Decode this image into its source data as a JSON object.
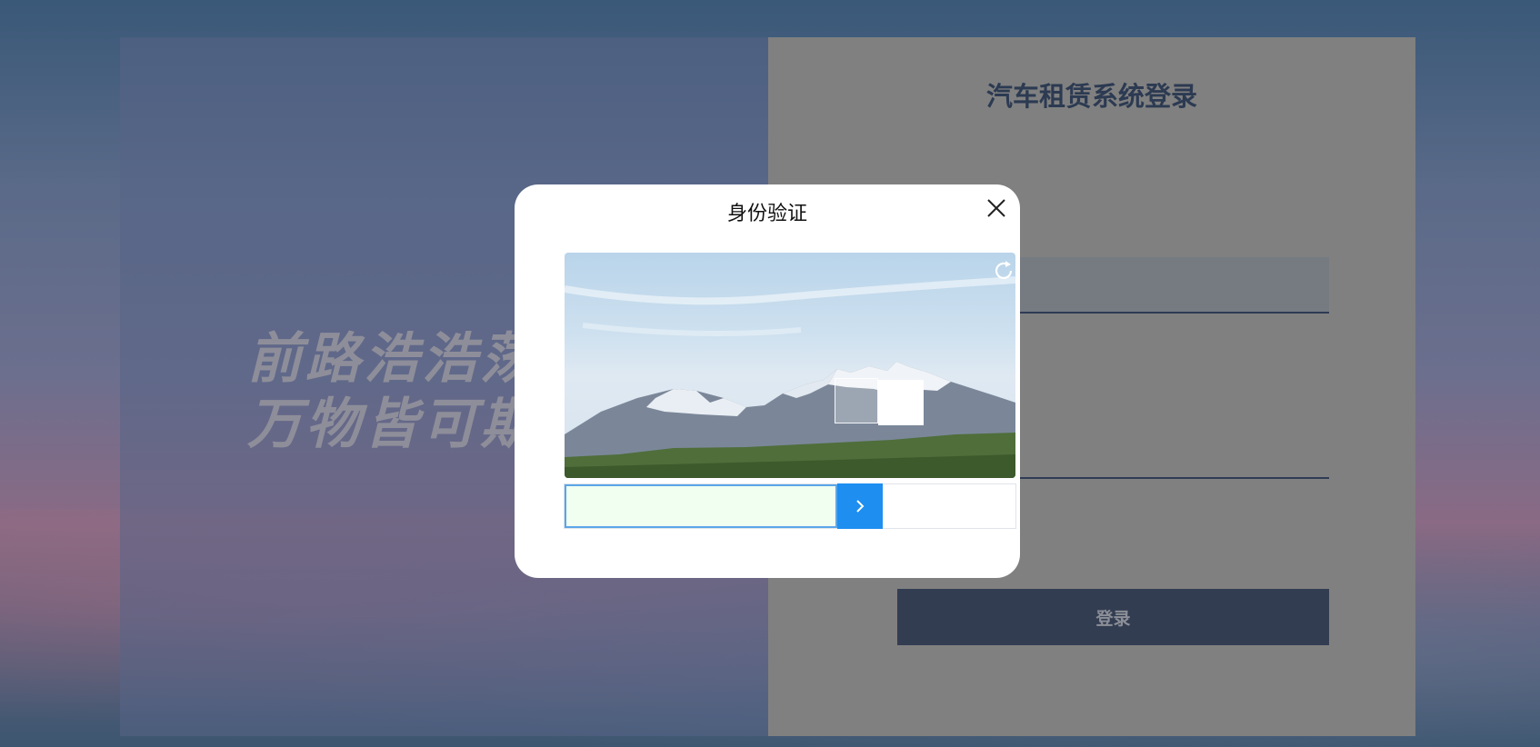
{
  "login": {
    "title": "汽车租赁系统登录",
    "submit_label": "登录"
  },
  "slogan": {
    "line1": "前路浩浩荡荡",
    "line2": "万物皆可期待"
  },
  "captcha": {
    "title": "身份验证",
    "slider_progress": 0.6
  },
  "colors": {
    "accent": "#1e8ef0",
    "slider_fill": "#f0fff0",
    "login_button": "#333d52",
    "title_text": "#2c3a52"
  },
  "icons": {
    "close": "close-icon",
    "refresh": "refresh-icon",
    "slider_arrow": "chevron-right-icon"
  }
}
